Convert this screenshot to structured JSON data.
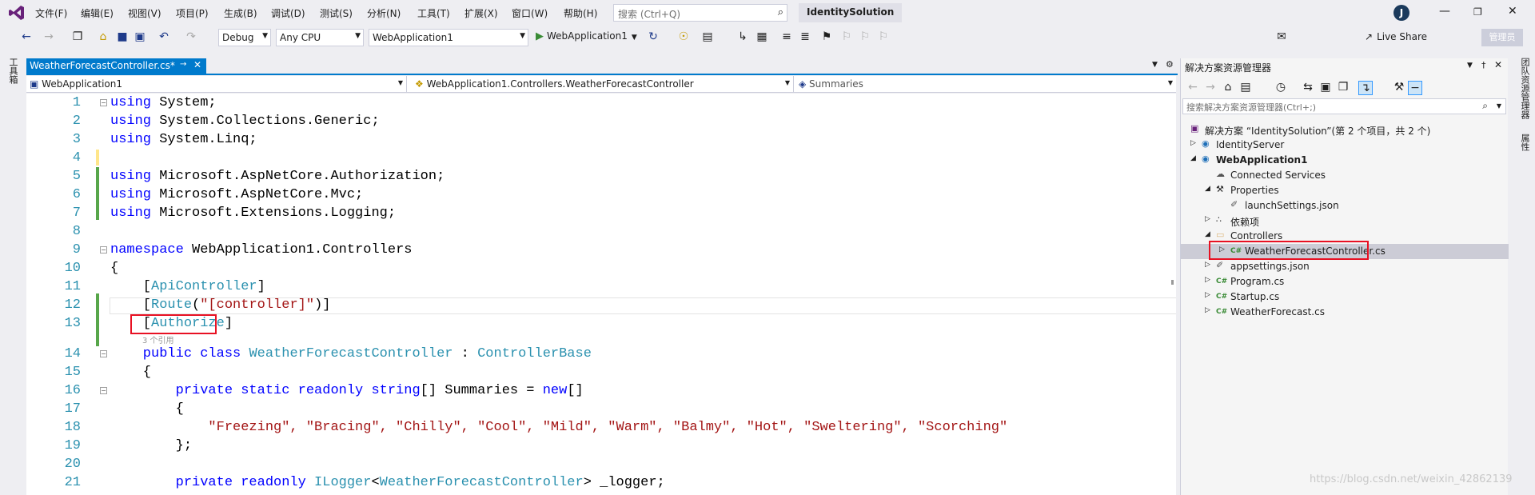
{
  "menu": {
    "items": [
      "文件(F)",
      "编辑(E)",
      "视图(V)",
      "项目(P)",
      "生成(B)",
      "调试(D)",
      "测试(S)",
      "分析(N)",
      "工具(T)",
      "扩展(X)",
      "窗口(W)",
      "帮助(H)"
    ],
    "search_placeholder": "搜索 (Ctrl+Q)",
    "solution_name": "IdentitySolution",
    "avatar_letter": "J"
  },
  "toolbar": {
    "config": "Debug",
    "platform": "Any CPU",
    "startup_project": "WebApplication1",
    "run_label": "WebApplication1",
    "live_share": "Live Share",
    "admin": "管理员"
  },
  "left_strip_label": "工具箱",
  "right_strip_labels": [
    "团队资源管理器",
    "属性"
  ],
  "editor": {
    "tab_label": "WeatherForecastController.cs*",
    "nav_project": "WebApplication1",
    "nav_class": "WebApplication1.Controllers.WeatherForecastController",
    "nav_member": "Summaries",
    "ref_hint": "3 个引用",
    "line_numbers": [
      "1",
      "2",
      "3",
      "4",
      "5",
      "6",
      "7",
      "8",
      "9",
      "10",
      "11",
      "12",
      "13",
      "14",
      "15",
      "16",
      "17",
      "18",
      "19",
      "20",
      "21"
    ],
    "lines": {
      "l1a": "using",
      "l1b": " System;",
      "l2a": "using",
      "l2b": " System.Collections.Generic;",
      "l3a": "using",
      "l3b": " System.Linq;",
      "l5a": "using",
      "l5b": " Microsoft.AspNetCore.Authorization;",
      "l6a": "using",
      "l6b": " Microsoft.AspNetCore.Mvc;",
      "l7a": "using",
      "l7b": " Microsoft.Extensions.Logging;",
      "l9a": "namespace",
      "l9b": " WebApplication1.Controllers",
      "l10": "{",
      "l11a": "    [",
      "l11b": "ApiController",
      "l11c": "]",
      "l12a": "    [",
      "l12b": "Route",
      "l12c": "(",
      "l12d": "\"[controller]\"",
      "l12e": ")]",
      "l13a": "    [",
      "l13b": "Authorize",
      "l13c": "]",
      "l14a": "    public class ",
      "l14b": "WeatherForecastController",
      "l14c": " : ",
      "l14d": "ControllerBase",
      "l15": "    {",
      "l16a": "        private static readonly string",
      "l16b": "[] Summaries = ",
      "l16c": "new",
      "l16d": "[]",
      "l17": "        {",
      "l18": "            \"Freezing\", \"Bracing\", \"Chilly\", \"Cool\", \"Mild\", \"Warm\", \"Balmy\", \"Hot\", \"Sweltering\", \"Scorching\"",
      "l19": "        };",
      "l21a": "        private readonly ",
      "l21b": "ILogger",
      "l21c": "<",
      "l21d": "WeatherForecastController",
      "l21e": "> _logger;"
    }
  },
  "solution_explorer": {
    "title": "解决方案资源管理器",
    "search_placeholder": "搜索解决方案资源管理器(Ctrl+;)",
    "nodes": [
      {
        "label": "解决方案 “IdentitySolution”(第 2 个项目，共 2 个)",
        "icon": "solution-icon"
      },
      {
        "label": "IdentityServer",
        "icon": "project-icon"
      },
      {
        "label": "WebApplication1",
        "icon": "project-icon"
      },
      {
        "label": "Connected Services",
        "icon": "cloud-icon"
      },
      {
        "label": "Properties",
        "icon": "wrench-icon"
      },
      {
        "label": "launchSettings.json",
        "icon": "json-icon"
      },
      {
        "label": "依赖项",
        "icon": "dependency-icon"
      },
      {
        "label": "Controllers",
        "icon": "folder-icon"
      },
      {
        "label": "WeatherForecastController.cs",
        "icon": "csharp-file-icon"
      },
      {
        "label": "appsettings.json",
        "icon": "json-icon"
      },
      {
        "label": "Program.cs",
        "icon": "csharp-file-icon"
      },
      {
        "label": "Startup.cs",
        "icon": "csharp-file-icon"
      },
      {
        "label": "WeatherForecast.cs",
        "icon": "csharp-file-icon"
      }
    ]
  },
  "watermark": "https://blog.csdn.net/weixin_42862139",
  "colors": {
    "accent": "#007acc",
    "keyword": "#0000ff",
    "type": "#2b91af",
    "string": "#a31515",
    "highlight_box": "#e81123",
    "changed_line": "#57a64a"
  }
}
